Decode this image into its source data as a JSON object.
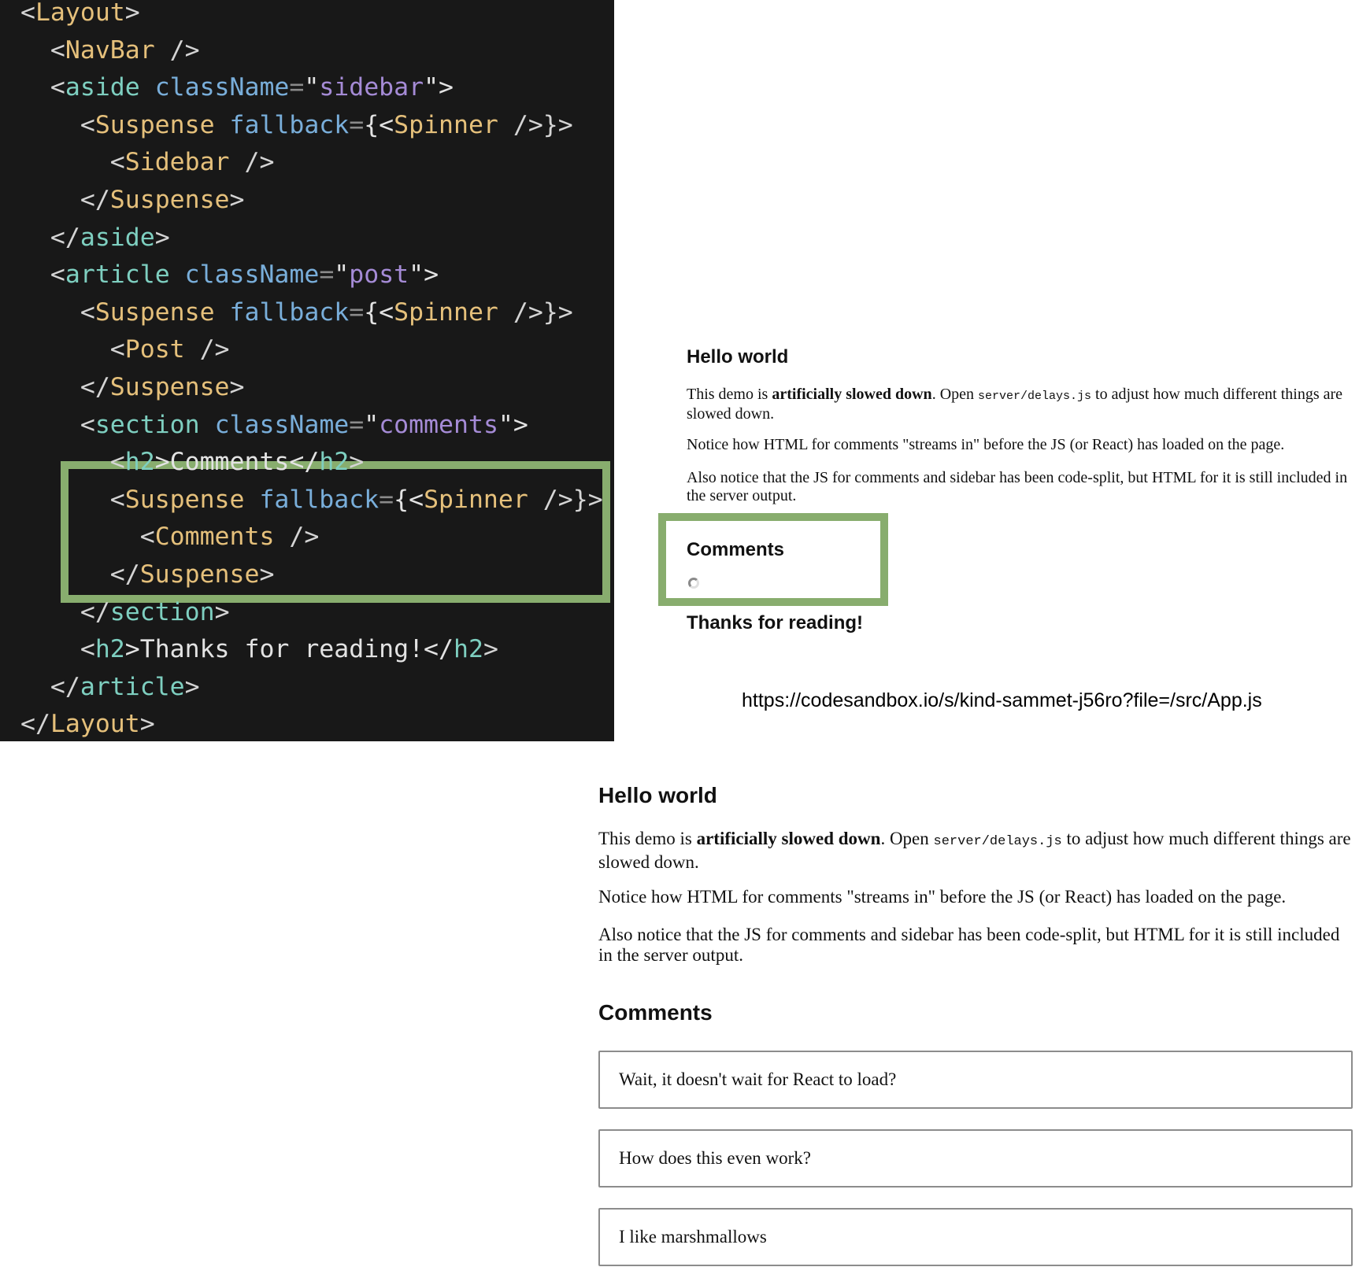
{
  "code": {
    "lines": [
      [
        {
          "t": "<",
          "c": "punct"
        },
        {
          "t": "Layout",
          "c": "comp"
        },
        {
          "t": ">",
          "c": "punct"
        }
      ],
      [
        {
          "t": "  <",
          "c": "punct"
        },
        {
          "t": "NavBar",
          "c": "comp"
        },
        {
          "t": " />",
          "c": "punct"
        }
      ],
      [
        {
          "t": "  <",
          "c": "punct"
        },
        {
          "t": "aside",
          "c": "tag"
        },
        {
          "t": " ",
          "c": "punct"
        },
        {
          "t": "className",
          "c": "attr"
        },
        {
          "t": "=",
          "c": "eq"
        },
        {
          "t": "\"",
          "c": "text"
        },
        {
          "t": "sidebar",
          "c": "str"
        },
        {
          "t": "\">",
          "c": "text"
        }
      ],
      [
        {
          "t": "    <",
          "c": "punct"
        },
        {
          "t": "Suspense",
          "c": "comp"
        },
        {
          "t": " ",
          "c": "punct"
        },
        {
          "t": "fallback",
          "c": "attr"
        },
        {
          "t": "=",
          "c": "eq"
        },
        {
          "t": "{<",
          "c": "text"
        },
        {
          "t": "Spinner",
          "c": "comp"
        },
        {
          "t": " />}>",
          "c": "punct"
        }
      ],
      [
        {
          "t": "      <",
          "c": "punct"
        },
        {
          "t": "Sidebar",
          "c": "comp"
        },
        {
          "t": " />",
          "c": "punct"
        }
      ],
      [
        {
          "t": "    </",
          "c": "punct"
        },
        {
          "t": "Suspense",
          "c": "comp"
        },
        {
          "t": ">",
          "c": "punct"
        }
      ],
      [
        {
          "t": "  </",
          "c": "punct"
        },
        {
          "t": "aside",
          "c": "tag"
        },
        {
          "t": ">",
          "c": "punct"
        }
      ],
      [
        {
          "t": "  <",
          "c": "punct"
        },
        {
          "t": "article",
          "c": "tag"
        },
        {
          "t": " ",
          "c": "punct"
        },
        {
          "t": "className",
          "c": "attr"
        },
        {
          "t": "=",
          "c": "eq"
        },
        {
          "t": "\"",
          "c": "text"
        },
        {
          "t": "post",
          "c": "str"
        },
        {
          "t": "\">",
          "c": "text"
        }
      ],
      [
        {
          "t": "    <",
          "c": "punct"
        },
        {
          "t": "Suspense",
          "c": "comp"
        },
        {
          "t": " ",
          "c": "punct"
        },
        {
          "t": "fallback",
          "c": "attr"
        },
        {
          "t": "=",
          "c": "eq"
        },
        {
          "t": "{<",
          "c": "text"
        },
        {
          "t": "Spinner",
          "c": "comp"
        },
        {
          "t": " />}>",
          "c": "punct"
        }
      ],
      [
        {
          "t": "      <",
          "c": "punct"
        },
        {
          "t": "Post",
          "c": "comp"
        },
        {
          "t": " />",
          "c": "punct"
        }
      ],
      [
        {
          "t": "    </",
          "c": "punct"
        },
        {
          "t": "Suspense",
          "c": "comp"
        },
        {
          "t": ">",
          "c": "punct"
        }
      ],
      [
        {
          "t": "    <",
          "c": "punct"
        },
        {
          "t": "section",
          "c": "tag"
        },
        {
          "t": " ",
          "c": "punct"
        },
        {
          "t": "className",
          "c": "attr"
        },
        {
          "t": "=",
          "c": "eq"
        },
        {
          "t": "\"",
          "c": "text"
        },
        {
          "t": "comments",
          "c": "str"
        },
        {
          "t": "\">",
          "c": "text"
        }
      ],
      [
        {
          "t": "      <",
          "c": "punct"
        },
        {
          "t": "h2",
          "c": "tag"
        },
        {
          "t": ">Comments</",
          "c": "text"
        },
        {
          "t": "h2",
          "c": "tag"
        },
        {
          "t": ">",
          "c": "punct"
        }
      ],
      [
        {
          "t": "      <",
          "c": "punct"
        },
        {
          "t": "Suspense",
          "c": "comp"
        },
        {
          "t": " ",
          "c": "punct"
        },
        {
          "t": "fallback",
          "c": "attr"
        },
        {
          "t": "=",
          "c": "eq"
        },
        {
          "t": "{<",
          "c": "text"
        },
        {
          "t": "Spinner",
          "c": "comp"
        },
        {
          "t": " />}>",
          "c": "punct"
        }
      ],
      [
        {
          "t": "        <",
          "c": "punct"
        },
        {
          "t": "Comments",
          "c": "comp"
        },
        {
          "t": " />",
          "c": "punct"
        }
      ],
      [
        {
          "t": "      </",
          "c": "punct"
        },
        {
          "t": "Suspense",
          "c": "comp"
        },
        {
          "t": ">",
          "c": "punct"
        }
      ],
      [
        {
          "t": "    </",
          "c": "punct"
        },
        {
          "t": "section",
          "c": "tag"
        },
        {
          "t": ">",
          "c": "punct"
        }
      ],
      [
        {
          "t": "    <",
          "c": "punct"
        },
        {
          "t": "h2",
          "c": "tag"
        },
        {
          "t": ">Thanks for reading!</",
          "c": "text"
        },
        {
          "t": "h2",
          "c": "tag"
        },
        {
          "t": ">",
          "c": "punct"
        }
      ],
      [
        {
          "t": "  </",
          "c": "punct"
        },
        {
          "t": "article",
          "c": "tag"
        },
        {
          "t": ">",
          "c": "punct"
        }
      ],
      [
        {
          "t": "</",
          "c": "punct"
        },
        {
          "t": "Layout",
          "c": "comp"
        },
        {
          "t": ">",
          "c": "punct"
        }
      ]
    ],
    "colors": {
      "background": "#181818",
      "component": "#e5c07b",
      "html_tag": "#7ecfc0",
      "attribute": "#79aeda",
      "string": "#a58bd6",
      "highlight_border": "#88ad6e"
    }
  },
  "render_loading": {
    "title": "Hello world",
    "intro_prefix": "This demo is ",
    "intro_bold": "artificially slowed down",
    "intro_mid": ". Open ",
    "intro_code": "server/delays.js",
    "intro_suffix": " to adjust how much different things are slowed down.",
    "notice": "Notice how HTML for comments \"streams in\" before the JS (or React) has loaded on the page.",
    "also": "Also notice that the JS for comments and sidebar has been code-split, but HTML for it is still included in the server output.",
    "comments_heading": "Comments",
    "spinner_icon": "spinner-icon",
    "thanks": "Thanks for reading!"
  },
  "url": "https://codesandbox.io/s/kind-sammet-j56ro?file=/src/App.js",
  "render_loaded": {
    "title": "Hello world",
    "intro_prefix": "This demo is ",
    "intro_bold": "artificially slowed down",
    "intro_mid": ". Open ",
    "intro_code": "server/delays.js",
    "intro_suffix": " to adjust how much different things are slowed down.",
    "notice": "Notice how HTML for comments \"streams in\" before the JS (or React) has loaded on the page.",
    "also": "Also notice that the JS for comments and sidebar has been code-split, but HTML for it is still included in the server output.",
    "comments_heading": "Comments",
    "comments": [
      "Wait, it doesn't wait for React to load?",
      "How does this even work?",
      "I like marshmallows"
    ]
  }
}
